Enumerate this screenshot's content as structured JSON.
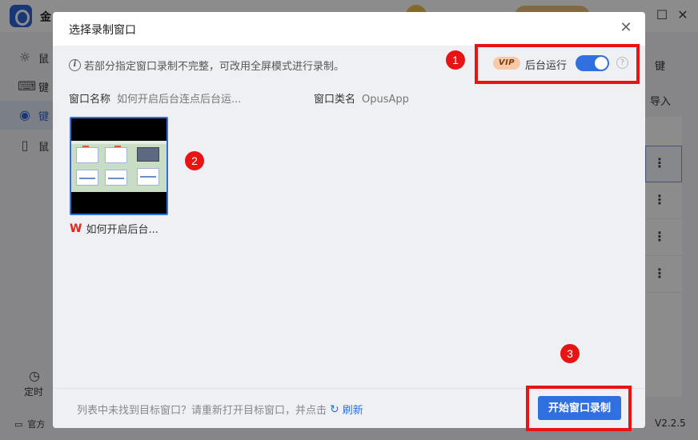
{
  "app": {
    "name": "金",
    "version": "V2.2.5",
    "official": "官方",
    "sidebar": [
      {
        "icon": "mouse-click-icon",
        "label": "鼠"
      },
      {
        "icon": "keyboard-icon",
        "label": "键"
      },
      {
        "icon": "webcam-icon",
        "label": "键"
      },
      {
        "icon": "mouse-icon",
        "label": "鼠"
      }
    ],
    "timer_label": "定时",
    "bg_shortcut": "键",
    "bg_import": "导入"
  },
  "dialog": {
    "title": "选择录制窗口",
    "notice": "若部分指定窗口录制不完整，可改用全屏模式进行录制。",
    "vip_badge": "VIP",
    "background_run_label": "后台运行",
    "background_run_enabled": true,
    "window_name_label": "窗口名称",
    "window_name_value": "如何开启后台连点后台运...",
    "window_class_label": "窗口类名",
    "window_class_value": "OpusApp",
    "windows": [
      {
        "caption": "如何开启后台...",
        "app_icon": "wps-icon",
        "selected": true
      }
    ],
    "footer_tip": "列表中未找到目标窗口？请重新打开目标窗口，并点击",
    "refresh_label": "刷新",
    "start_button": "开始窗口录制"
  },
  "annotations": [
    "1",
    "2",
    "3"
  ],
  "colors": {
    "accent": "#2f6fe0",
    "highlight": "#e81414"
  }
}
